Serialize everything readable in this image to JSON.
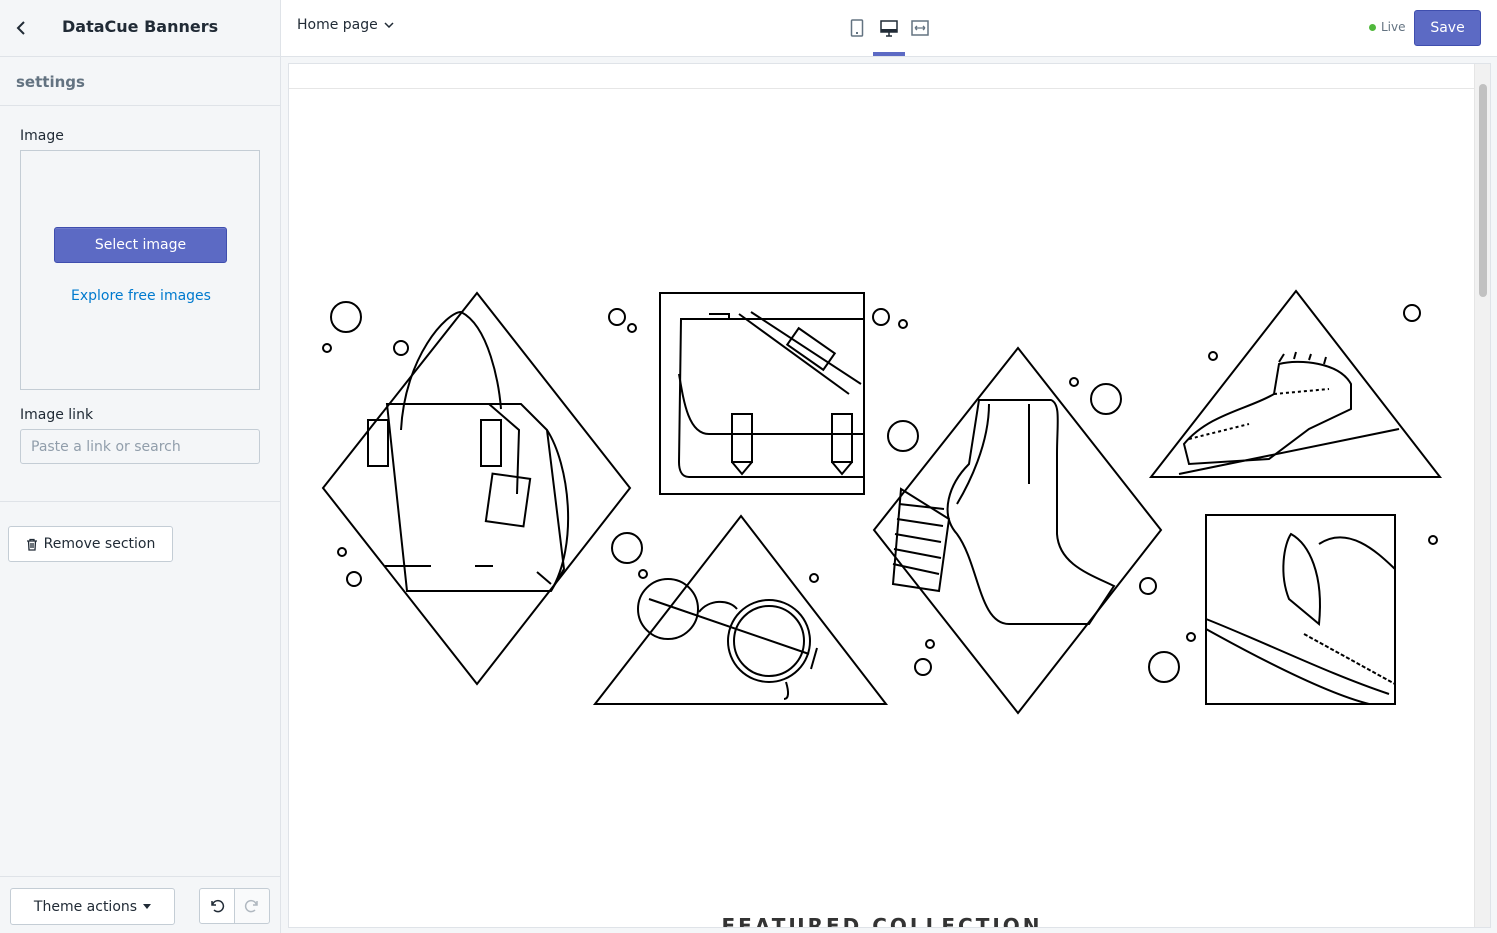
{
  "sidebar": {
    "title": "DataCue Banners",
    "settings_label": "settings",
    "image_label": "Image",
    "select_image_label": "Select image",
    "explore_label": "Explore free images",
    "image_link_label": "Image link",
    "image_link_placeholder": "Paste a link or search",
    "remove_label": "Remove section",
    "theme_actions_label": "Theme actions"
  },
  "topbar": {
    "page_select_value": "Home page",
    "live_label": "Live",
    "save_label": "Save",
    "devices": [
      "mobile-icon",
      "desktop-icon",
      "full-width-icon"
    ],
    "active_device": "desktop"
  },
  "preview": {
    "featured_heading": "FEATURED COLLECTION"
  },
  "colors": {
    "accent": "#5c6ac4",
    "link": "#007ace",
    "live": "#50b83c"
  }
}
